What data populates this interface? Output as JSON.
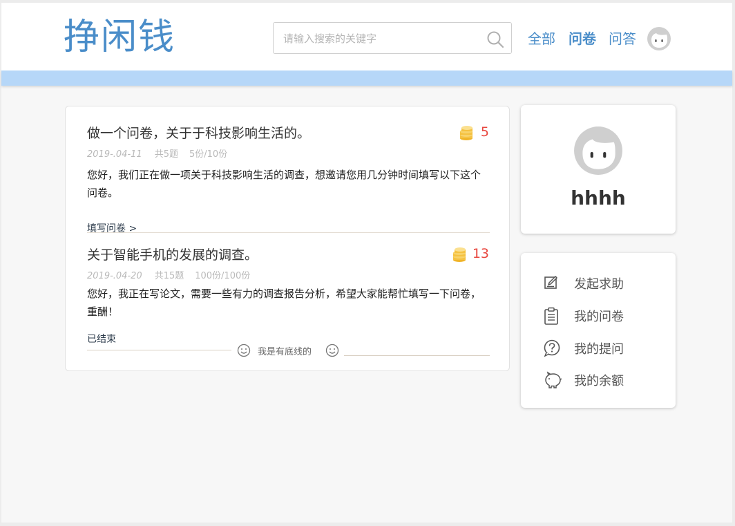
{
  "header": {
    "logo": "挣闲钱",
    "search": {
      "placeholder": "请输入搜索的关键字",
      "value": ""
    },
    "nav": [
      {
        "label": "全部",
        "active": false
      },
      {
        "label": "问卷",
        "active": true
      },
      {
        "label": "问答",
        "active": false
      }
    ]
  },
  "surveys": [
    {
      "title": "做一个问卷，关于于科技影响生活的。",
      "reward": "5",
      "date": "2019-.04-11",
      "questions": "共5题",
      "count": "5份/10份",
      "description": "您好，我们正在做一项关于科技影响生活的调查，想邀请您用几分钟时间填写以下这个问卷。",
      "action": "填写问卷 >"
    },
    {
      "title": "关于智能手机的发展的调查。",
      "reward": "13",
      "date": "2019-.04-20",
      "questions": "共15题",
      "count": "100份/100份",
      "description": "您好，我正在写论文，需要一些有力的调查报告分析，希望大家能帮忙填写一下问卷，重酬！",
      "action": "已结束"
    }
  ],
  "footer_note": "我是有底线的",
  "profile": {
    "username": "hhhh"
  },
  "menu": [
    {
      "icon": "edit-icon",
      "label": "发起求助"
    },
    {
      "icon": "clipboard-icon",
      "label": "我的问卷"
    },
    {
      "icon": "question-icon",
      "label": "我的提问"
    },
    {
      "icon": "piggy-bank-icon",
      "label": "我的余额"
    }
  ],
  "colors": {
    "brand": "#4a8dc9",
    "band": "#b6d7f8",
    "reward": "#e8473f",
    "coin": "#f5c242"
  }
}
